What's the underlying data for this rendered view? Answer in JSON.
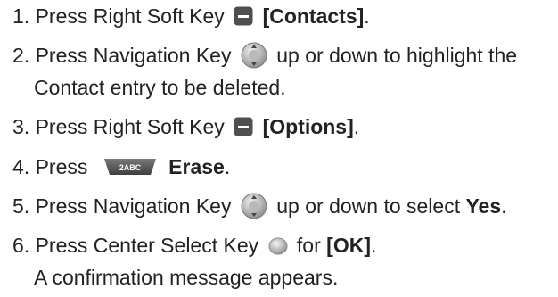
{
  "steps": [
    {
      "num": "1.",
      "pre": "Press Right Soft Key",
      "icon": "right-soft-key-icon",
      "bold": "[Contacts]",
      "post": "."
    },
    {
      "num": "2.",
      "pre": "Press Navigation Key",
      "icon": "navigation-key-icon",
      "post": "up or down to highlight the",
      "line2": "Contact entry to be deleted."
    },
    {
      "num": "3.",
      "pre": "Press Right Soft Key",
      "icon": "right-soft-key-icon",
      "bold": "[Options]",
      "post": "."
    },
    {
      "num": "4.",
      "pre": "Press",
      "icon": "2abc-key-icon",
      "key_label": "2ABC",
      "bold": "Erase",
      "post": "."
    },
    {
      "num": "5.",
      "pre": "Press Navigation Key",
      "icon": "navigation-key-icon",
      "post": "up or down to select",
      "bold": "Yes",
      "post2": "."
    },
    {
      "num": "6.",
      "pre": "Press Center Select Key",
      "icon": "center-select-key-icon",
      "mid": "for",
      "bold": "[OK]",
      "post": ".",
      "line2": "A confirmation message appears."
    }
  ],
  "colors": {
    "text": "#222222",
    "key_dark": "#5a5a5a",
    "key_light": "#d8d8d8"
  }
}
